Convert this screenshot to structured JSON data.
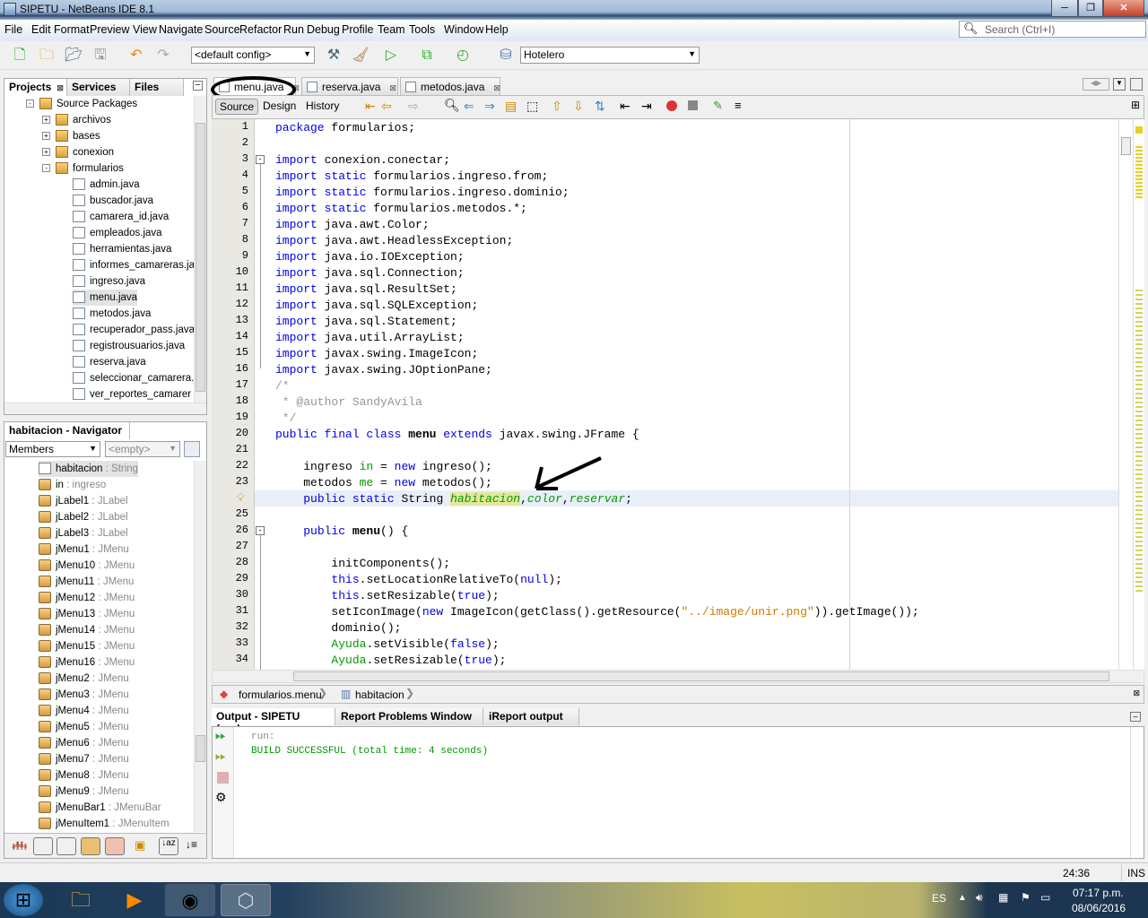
{
  "window": {
    "title": "SIPETU - NetBeans IDE 8.1",
    "minimize": "─",
    "restore": "❐",
    "close": "✕"
  },
  "menu": [
    "File",
    "Edit",
    "Format",
    "Preview",
    "View",
    "Navigate",
    "Source",
    "Refactor",
    "Run",
    "Debug",
    "Profile",
    "Team",
    "Tools",
    "Window",
    "Help"
  ],
  "search": {
    "placeholder": "Search (Ctrl+I)"
  },
  "toolbar": {
    "config": "<default config>",
    "project": "Hotelero"
  },
  "projects_panel": {
    "tabs": [
      "Projects",
      "Services",
      "Files"
    ],
    "root": "Source Packages",
    "packages": [
      "archivos",
      "bases",
      "conexion",
      "formularios"
    ],
    "files": [
      "admin.java",
      "buscador.java",
      "camarera_id.java",
      "empleados.java",
      "herramientas.java",
      "informes_camareras.ja",
      "ingreso.java",
      "menu.java",
      "metodos.java",
      "recuperador_pass.java",
      "registrousuarios.java",
      "reserva.java",
      "seleccionar_camarera.",
      "ver_reportes_camarer"
    ],
    "selected": "menu.java"
  },
  "navigator": {
    "title": "habitacion - Navigator",
    "filter": "Members",
    "empty": "<empty>",
    "items": [
      [
        "habitacion",
        "String"
      ],
      [
        "in",
        "ingreso"
      ],
      [
        "jLabel1",
        "JLabel"
      ],
      [
        "jLabel2",
        "JLabel"
      ],
      [
        "jLabel3",
        "JLabel"
      ],
      [
        "jMenu1",
        "JMenu"
      ],
      [
        "jMenu10",
        "JMenu"
      ],
      [
        "jMenu11",
        "JMenu"
      ],
      [
        "jMenu12",
        "JMenu"
      ],
      [
        "jMenu13",
        "JMenu"
      ],
      [
        "jMenu14",
        "JMenu"
      ],
      [
        "jMenu15",
        "JMenu"
      ],
      [
        "jMenu16",
        "JMenu"
      ],
      [
        "jMenu2",
        "JMenu"
      ],
      [
        "jMenu3",
        "JMenu"
      ],
      [
        "jMenu4",
        "JMenu"
      ],
      [
        "jMenu5",
        "JMenu"
      ],
      [
        "jMenu6",
        "JMenu"
      ],
      [
        "jMenu7",
        "JMenu"
      ],
      [
        "jMenu8",
        "JMenu"
      ],
      [
        "jMenu9",
        "JMenu"
      ],
      [
        "jMenuBar1",
        "JMenuBar"
      ],
      [
        "jMenuItem1",
        "JMenuItem"
      ]
    ]
  },
  "editor": {
    "tabs": [
      "menu.java",
      "reserva.java",
      "metodos.java"
    ],
    "active_tab": "menu.java",
    "modes": [
      "Source",
      "Design",
      "History"
    ],
    "active_mode": "Source",
    "current_line": 24,
    "lines": [
      [
        [
          "package",
          "kw"
        ],
        [
          " formularios;",
          ""
        ]
      ],
      [],
      [
        [
          "import",
          "kw"
        ],
        [
          " conexion.conectar;",
          ""
        ]
      ],
      [
        [
          "import static",
          "kw"
        ],
        [
          " formularios.ingreso.from;",
          ""
        ]
      ],
      [
        [
          "import static",
          "kw"
        ],
        [
          " formularios.ingreso.dominio;",
          ""
        ]
      ],
      [
        [
          "import static",
          "kw"
        ],
        [
          " formularios.metodos.*;",
          ""
        ]
      ],
      [
        [
          "import",
          "kw"
        ],
        [
          " java.awt.Color;",
          ""
        ]
      ],
      [
        [
          "import",
          "kw"
        ],
        [
          " java.awt.HeadlessException;",
          ""
        ]
      ],
      [
        [
          "import",
          "kw"
        ],
        [
          " java.io.IOException;",
          ""
        ]
      ],
      [
        [
          "import",
          "kw"
        ],
        [
          " java.sql.Connection;",
          ""
        ]
      ],
      [
        [
          "import",
          "kw"
        ],
        [
          " java.sql.ResultSet;",
          ""
        ]
      ],
      [
        [
          "import",
          "kw"
        ],
        [
          " java.sql.SQLException;",
          ""
        ]
      ],
      [
        [
          "import",
          "kw"
        ],
        [
          " java.sql.Statement;",
          ""
        ]
      ],
      [
        [
          "import",
          "kw"
        ],
        [
          " java.util.ArrayList;",
          ""
        ]
      ],
      [
        [
          "import",
          "kw"
        ],
        [
          " javax.swing.ImageIcon;",
          ""
        ]
      ],
      [
        [
          "import",
          "kw"
        ],
        [
          " javax.swing.JOptionPane;",
          ""
        ]
      ],
      [
        [
          "/*",
          "cm"
        ]
      ],
      [
        [
          " * @author SandyAvila",
          "cm"
        ]
      ],
      [
        [
          " */",
          "cm"
        ]
      ],
      [
        [
          "public final class",
          "kw"
        ],
        [
          " menu ",
          "bold"
        ],
        [
          "extends",
          "kw"
        ],
        [
          " javax.swing.JFrame {",
          ""
        ]
      ],
      [],
      [
        [
          "    ingreso ",
          ""
        ],
        [
          "in",
          "gr"
        ],
        [
          " = ",
          ""
        ],
        [
          "new",
          "kw"
        ],
        [
          " ingreso();",
          ""
        ]
      ],
      [
        [
          "    metodos ",
          ""
        ],
        [
          "me",
          "gr"
        ],
        [
          " = ",
          ""
        ],
        [
          "new",
          "kw"
        ],
        [
          " metodos();",
          ""
        ]
      ],
      [
        [
          "    ",
          ""
        ],
        [
          "public static",
          "kw"
        ],
        [
          " String ",
          ""
        ],
        [
          "habitacion",
          "fd mark"
        ],
        [
          ",",
          ""
        ],
        [
          "color",
          "fd"
        ],
        [
          ",",
          ""
        ],
        [
          "reservar",
          "fd"
        ],
        [
          ";",
          ""
        ]
      ],
      [],
      [
        [
          "    ",
          ""
        ],
        [
          "public",
          "kw"
        ],
        [
          " menu",
          "bold"
        ],
        [
          "() {",
          ""
        ]
      ],
      [],
      [
        [
          "        initComponents();",
          ""
        ]
      ],
      [
        [
          "        ",
          ""
        ],
        [
          "this",
          "kw"
        ],
        [
          ".setLocationRelativeTo(",
          ""
        ],
        [
          "null",
          "kw"
        ],
        [
          ");",
          ""
        ]
      ],
      [
        [
          "        ",
          ""
        ],
        [
          "this",
          "kw"
        ],
        [
          ".setResizable(",
          ""
        ],
        [
          "true",
          "kw"
        ],
        [
          ");",
          ""
        ]
      ],
      [
        [
          "        setIconImage(",
          ""
        ],
        [
          "new",
          "kw"
        ],
        [
          " ImageIcon(getClass().getResource(",
          ""
        ],
        [
          "\"../image/unir.png\"",
          "st"
        ],
        [
          ")).getImage());",
          ""
        ]
      ],
      [
        [
          "        dominio();",
          ""
        ]
      ],
      [
        [
          "        ",
          ""
        ],
        [
          "Ayuda",
          "gr"
        ],
        [
          ".setVisible(",
          ""
        ],
        [
          "false",
          "kw"
        ],
        [
          ");",
          ""
        ]
      ],
      [
        [
          "        ",
          ""
        ],
        [
          "Ayuda",
          "gr"
        ],
        [
          ".setResizable(",
          ""
        ],
        [
          "true",
          "kw"
        ],
        [
          ");",
          ""
        ]
      ]
    ]
  },
  "breadcrumb": [
    "formularios.menu",
    "habitacion"
  ],
  "output": {
    "tabs": [
      "Output - SIPETU (run)",
      "Report Problems Window",
      "iReport output"
    ],
    "lines": [
      "run:",
      "BUILD SUCCESSFUL (total time: 4 seconds)"
    ]
  },
  "status": {
    "position": "24:36",
    "mode": "INS"
  },
  "taskbar": {
    "lang": "ES",
    "time": "07:17 p.m.",
    "date": "08/06/2016"
  },
  "colors": {
    "keyword": "#0000e6",
    "field": "#009900",
    "string": "#ce7b00",
    "comment": "#969696",
    "current_line": "#e9eff8"
  }
}
